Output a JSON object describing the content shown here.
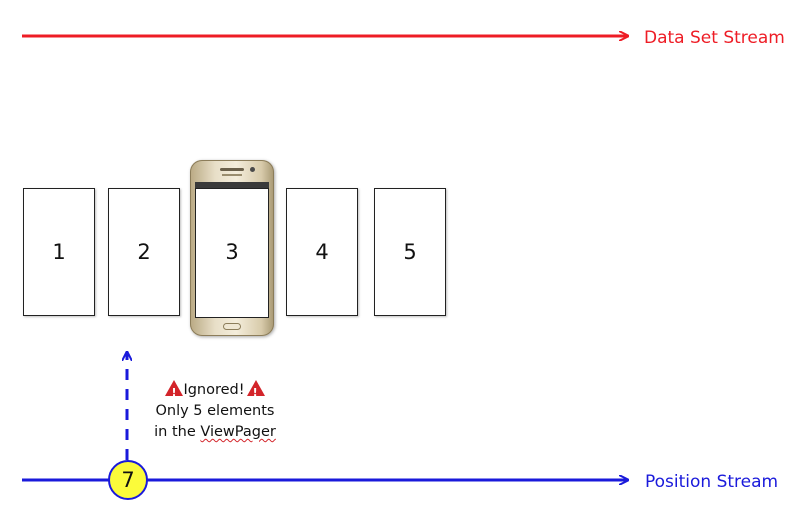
{
  "streams": {
    "data_set": {
      "label": "Data Set Stream",
      "color": "#ee1c25"
    },
    "position": {
      "label": "Position Stream",
      "color": "#1a1adb"
    }
  },
  "pages": [
    "1",
    "2",
    "3",
    "4",
    "5"
  ],
  "note": {
    "line1": "Ignored!",
    "line2": "Only 5 elements",
    "line3_prefix": "in the ",
    "line3_word": "ViewPager"
  },
  "position_event": {
    "value": "7",
    "badge_color": "#fbfb3a"
  },
  "icons": {
    "warning": "warning-triangle-icon",
    "device": "smartphone-icon"
  }
}
